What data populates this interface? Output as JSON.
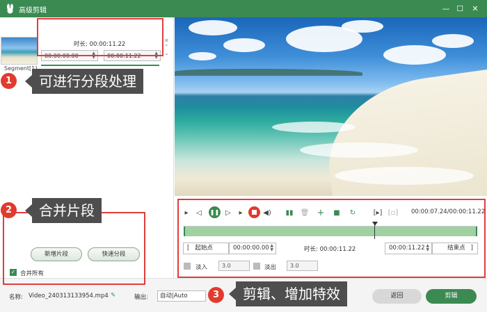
{
  "window": {
    "title": "高级剪辑"
  },
  "segment": {
    "label": "Segment[1]",
    "duration_text": "时长: 00:00:11.22",
    "start_time": "00:00:00.00",
    "end_time": "00:00:11.22",
    "separator": "-"
  },
  "callouts": [
    {
      "number": "1",
      "text": "可进行分段处理"
    },
    {
      "number": "2",
      "text": "合并片段"
    },
    {
      "number": "3",
      "text": "剪辑、增加特效"
    }
  ],
  "left_actions": {
    "new_segment": "新增片段",
    "quick_split": "快速分段",
    "merge_all": "合并所有"
  },
  "player": {
    "time_readout": "00:00:07.24/00:00:11.22",
    "progress_fraction": 0.65
  },
  "trim": {
    "start_label": "起始点",
    "start_value": "00:00:00.00",
    "duration_text": "时长: 00:00:11.22",
    "end_value": "00:00:11.22",
    "end_label": "结束点",
    "fade_in_label": "淡入",
    "fade_in_value": "3.0",
    "fade_out_label": "淡出",
    "fade_out_value": "3.0"
  },
  "footer": {
    "name_label": "名称:",
    "file_name": "Video_240313133954.mp4",
    "output_label": "输出:",
    "output_value": "自动|Auto",
    "back_label": "返回",
    "edit_label": "剪辑"
  },
  "colors": {
    "accent": "#3b8a52",
    "highlight": "#e03c3c",
    "callout_bg": "#4e4e4e"
  }
}
